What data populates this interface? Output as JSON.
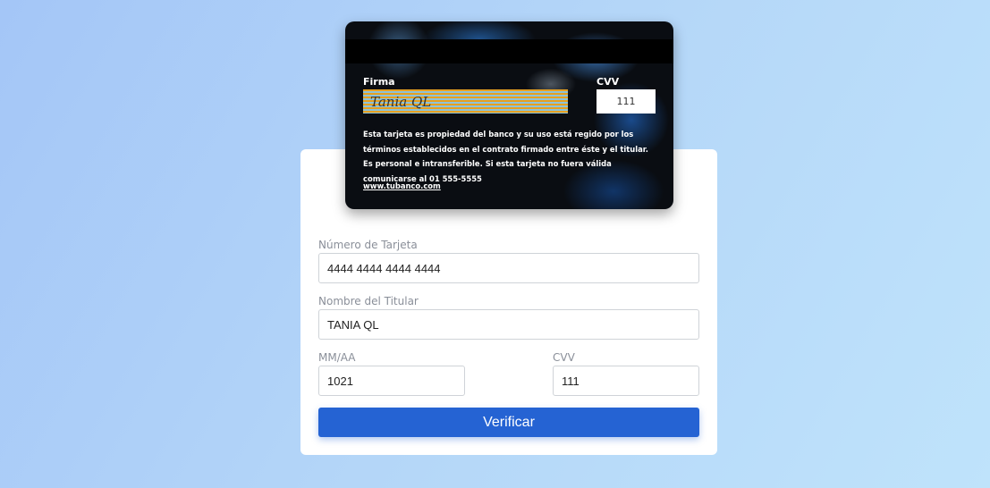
{
  "card": {
    "signature_label": "Firma",
    "signature_value": "Tania QL",
    "cvv_label": "CVV",
    "cvv_value": "111",
    "terms_text": "Esta tarjeta es propiedad del banco y su uso está regido por los términos establecidos en el contrato firmado entre éste y el titular. Es personal e intransferible. Si esta tarjeta no fuera válida comunicarse al 01 555-5555",
    "link_text": "www.tubanco.com"
  },
  "form": {
    "card_number_label": "Número de Tarjeta",
    "card_number_value": "4444 4444 4444 4444",
    "holder_label": "Nombre del Titular",
    "holder_value": "TANIA QL",
    "expiry_label": "MM/AA",
    "expiry_value": "1021",
    "cvv_label": "CVV",
    "cvv_value": "111",
    "submit_label": "Verificar"
  },
  "colors": {
    "accent": "#2563d3",
    "background_start": "#a4c6f7",
    "background_end": "#bfe3fb"
  }
}
